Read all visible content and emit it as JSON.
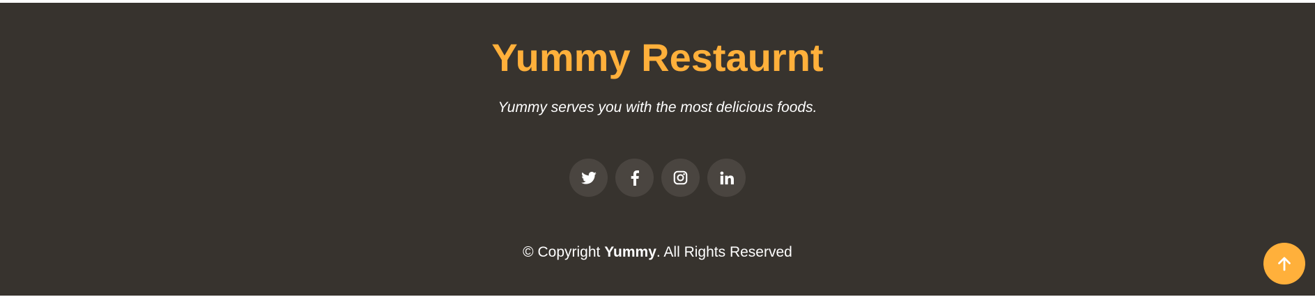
{
  "footer": {
    "brand": "Yummy Restaurnt",
    "tagline": "Yummy serves you with the most delicious foods.",
    "socials": [
      {
        "icon": "twitter-icon"
      },
      {
        "icon": "facebook-icon"
      },
      {
        "icon": "instagram-icon"
      },
      {
        "icon": "linkedin-icon"
      }
    ],
    "copyright": {
      "prefix": "© Copyright ",
      "name": "Yummy",
      "suffix": ". All Rights Reserved"
    },
    "back_to_top": {
      "icon": "arrow-up-icon"
    }
  },
  "colors": {
    "background": "#37332e",
    "accent": "#ffb03b",
    "social_bg": "#4a4540",
    "text": "#ffffff"
  }
}
